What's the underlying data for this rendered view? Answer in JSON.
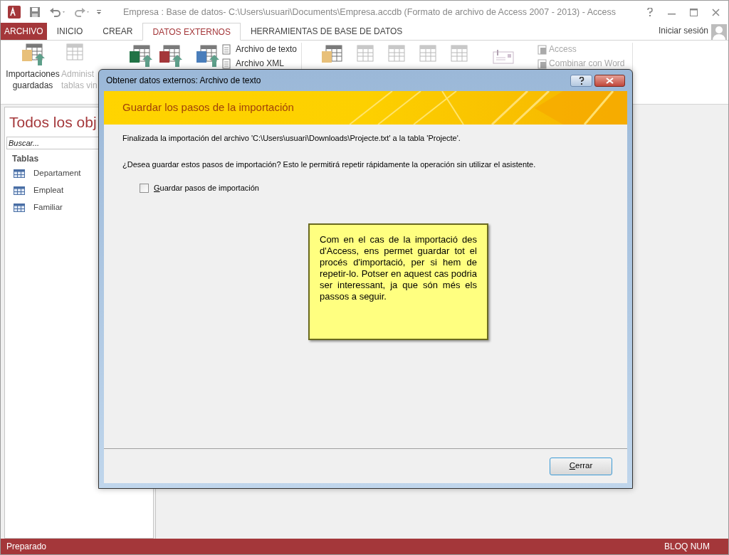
{
  "window": {
    "title": "Empresa : Base de datos- C:\\Users\\usuari\\Documents\\Empresa.accdb (Formato de archivo de Access 2007 - 2013) - Access"
  },
  "ribbon_tabs": [
    {
      "label": "ARCHIVO",
      "kind": "file",
      "selected": false
    },
    {
      "label": "INICIO",
      "kind": "tab",
      "selected": false
    },
    {
      "label": "CREAR",
      "kind": "tab",
      "selected": false
    },
    {
      "label": "DATOS EXTERNOS",
      "kind": "tab",
      "selected": true
    },
    {
      "label": "HERRAMIENTAS DE BASE DE DATOS",
      "kind": "tab",
      "selected": false
    }
  ],
  "account": {
    "label": "Iniciar sesión"
  },
  "ribbon": {
    "large": [
      {
        "lines": [
          "Importaciones",
          "guardadas"
        ],
        "disabled": false
      },
      {
        "lines": [
          "Administ",
          "tablas vin"
        ],
        "disabled": true
      }
    ],
    "import_small": [
      {
        "label": "Archivo de texto",
        "disabled": false
      },
      {
        "label": "Archivo XML",
        "disabled": false
      }
    ],
    "export_small": [
      {
        "label": "Access",
        "disabled": true
      },
      {
        "label": "Combinar con Word",
        "disabled": true
      }
    ]
  },
  "nav_pane": {
    "title": "Todos los obj",
    "search": {
      "placeholder": "Buscar..."
    },
    "group": "Tablas",
    "items": [
      "Departament",
      "Empleat",
      "Familiar"
    ]
  },
  "dialog": {
    "title": "Obtener datos externos: Archivo de texto",
    "header": "Guardar los pasos de la importación",
    "message": "Finalizada la importación del archivo 'C:\\Users\\usuari\\Downloads\\Projecte.txt' a la tabla 'Projecte'.",
    "question": "¿Desea guardar estos pasos de importación? Esto le permitirá repetir rápidamente la operación sin utilizar el asistente.",
    "checkbox": {
      "label": "Guardar pasos de importación",
      "checked": false
    },
    "buttons": [
      "Cerrar"
    ]
  },
  "note": "Com en el cas de la importació des d'Access, ens permet guardar tot el procés d'importació, per si hem de repetir-lo. Potser en aquest cas podria ser interessant, ja que són més els passos a seguir.",
  "status_bar": {
    "left": "Preparado",
    "right": "BLOQ NUM"
  }
}
